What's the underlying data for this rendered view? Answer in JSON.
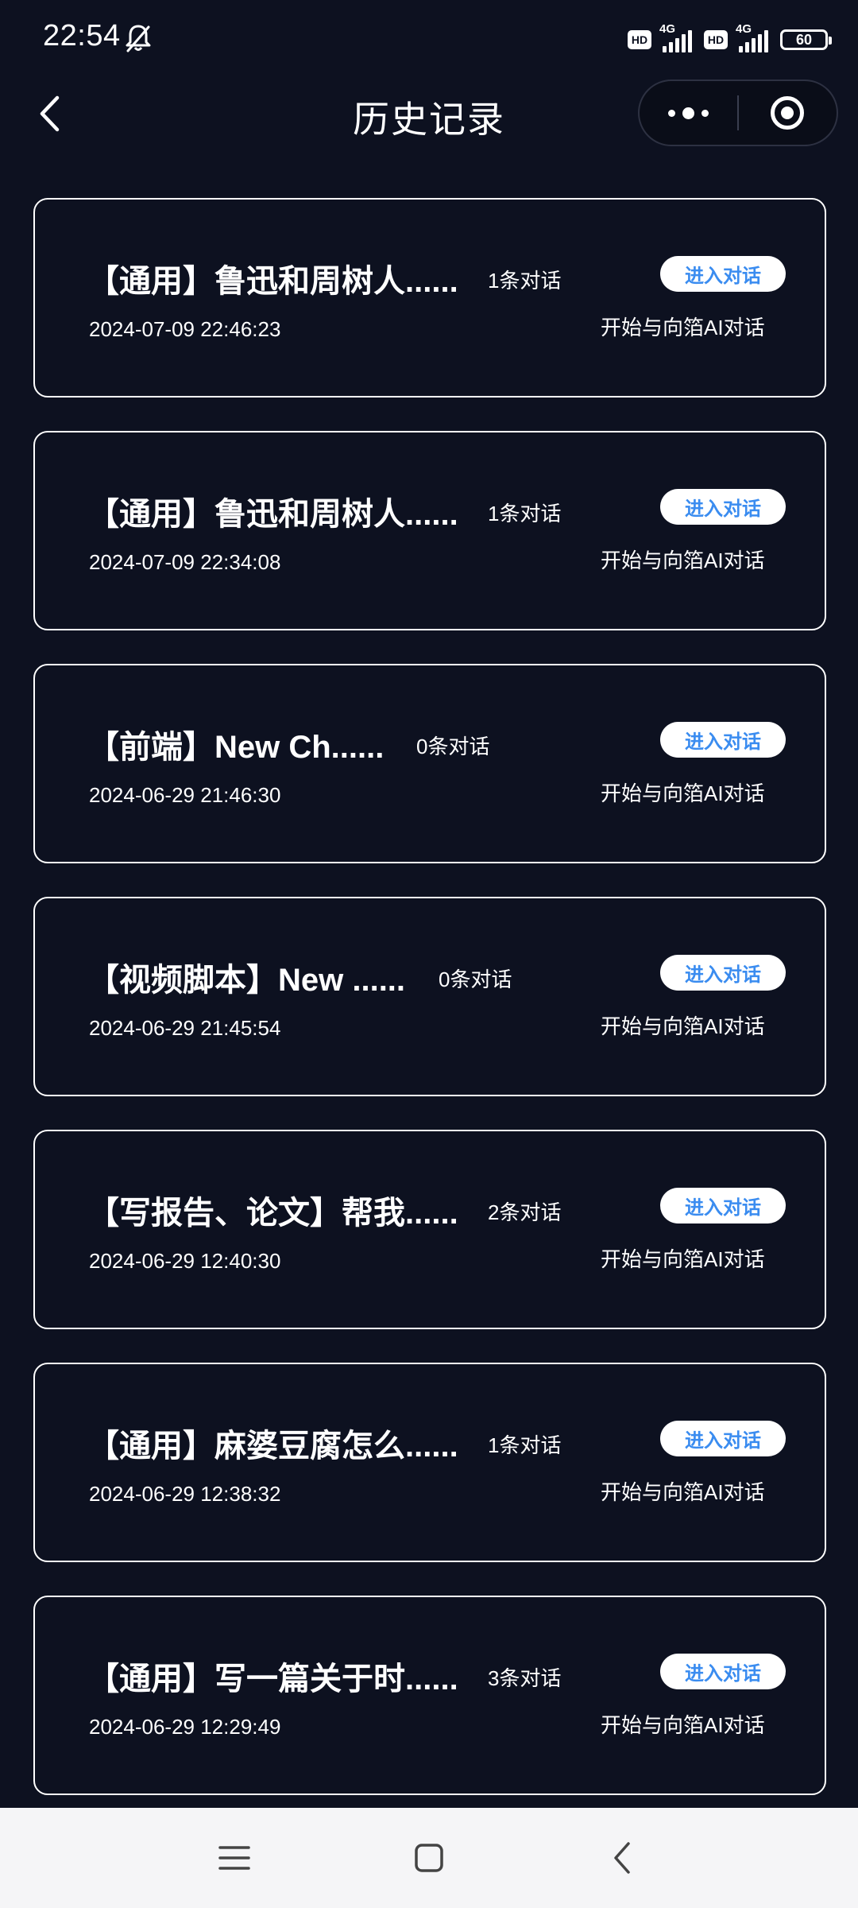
{
  "status_bar": {
    "time": "22:54",
    "hd_label": "HD",
    "network_label": "4G",
    "battery": "60"
  },
  "header": {
    "title": "历史记录"
  },
  "cards": [
    {
      "title": "【通用】鲁迅和周树人......",
      "count": "1条对话",
      "date": "2024-07-09 22:46:23",
      "button": "进入对话",
      "subtitle": "开始与向箔AI对话"
    },
    {
      "title": "【通用】鲁迅和周树人......",
      "count": "1条对话",
      "date": "2024-07-09 22:34:08",
      "button": "进入对话",
      "subtitle": "开始与向箔AI对话"
    },
    {
      "title": "【前端】New Ch......",
      "count": "0条对话",
      "date": "2024-06-29 21:46:30",
      "button": "进入对话",
      "subtitle": "开始与向箔AI对话"
    },
    {
      "title": "【视频脚本】New ......",
      "count": "0条对话",
      "date": "2024-06-29 21:45:54",
      "button": "进入对话",
      "subtitle": "开始与向箔AI对话"
    },
    {
      "title": "【写报告、论文】帮我......",
      "count": "2条对话",
      "date": "2024-06-29 12:40:30",
      "button": "进入对话",
      "subtitle": "开始与向箔AI对话"
    },
    {
      "title": "【通用】麻婆豆腐怎么......",
      "count": "1条对话",
      "date": "2024-06-29 12:38:32",
      "button": "进入对话",
      "subtitle": "开始与向箔AI对话"
    },
    {
      "title": "【通用】写一篇关于时......",
      "count": "3条对话",
      "date": "2024-06-29 12:29:49",
      "button": "进入对话",
      "subtitle": "开始与向箔AI对话"
    }
  ],
  "colors": {
    "background": "#0d1120",
    "accent": "#3a8cf0",
    "card_border": "#ffffff"
  },
  "icons": {
    "back": "chevron-left-icon",
    "more": "more-dots-icon",
    "close": "target-circle-icon",
    "bell": "bell-off-icon",
    "menu": "menu-icon",
    "home": "home-square-icon",
    "system_back": "system-back-icon"
  }
}
